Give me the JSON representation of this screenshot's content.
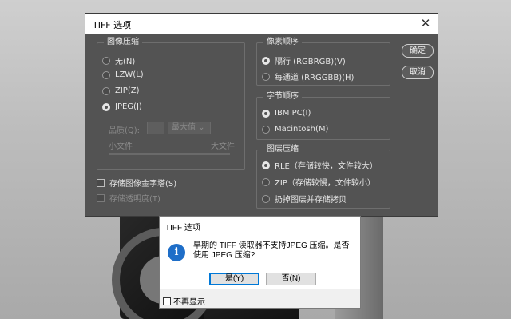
{
  "ps_dialog": {
    "title": "TIFF 选项",
    "close_glyph": "✕",
    "image_compression": {
      "legend": "图像压缩",
      "options": [
        "无(N)",
        "LZW(L)",
        "ZIP(Z)",
        "JPEG(J)"
      ],
      "selected_index": 3,
      "quality_label": "品质(Q):",
      "quality_preset": "最大值",
      "small_file": "小文件",
      "large_file": "大文件"
    },
    "save_image_pyramid": "存储图像金字塔(S)",
    "save_transparency": "存储透明度(T)",
    "pixel_order": {
      "legend": "像素顺序",
      "options": [
        "隔行 (RGBRGB)(V)",
        "每通道 (RRGGBB)(H)"
      ],
      "selected_index": 0
    },
    "byte_order": {
      "legend": "字节顺序",
      "options": [
        "IBM PC(I)",
        "Macintosh(M)"
      ],
      "selected_index": 0
    },
    "layer_compression": {
      "legend": "图层压缩",
      "options": [
        "RLE（存储较快，文件较大）",
        "ZIP（存储较慢，文件较小）",
        "扔掉图层并存储拷贝"
      ],
      "selected_index": 0
    },
    "ok_label": "确定",
    "cancel_label": "取消"
  },
  "alert": {
    "title": "TIFF 选项",
    "icon": "info-icon",
    "message": "早期的 TIFF 读取器不支持JPEG 压缩。是否使用 JPEG 压缩?",
    "yes_label": "是(Y)",
    "no_label": "否(N)",
    "dont_show_again": "不再显示"
  }
}
